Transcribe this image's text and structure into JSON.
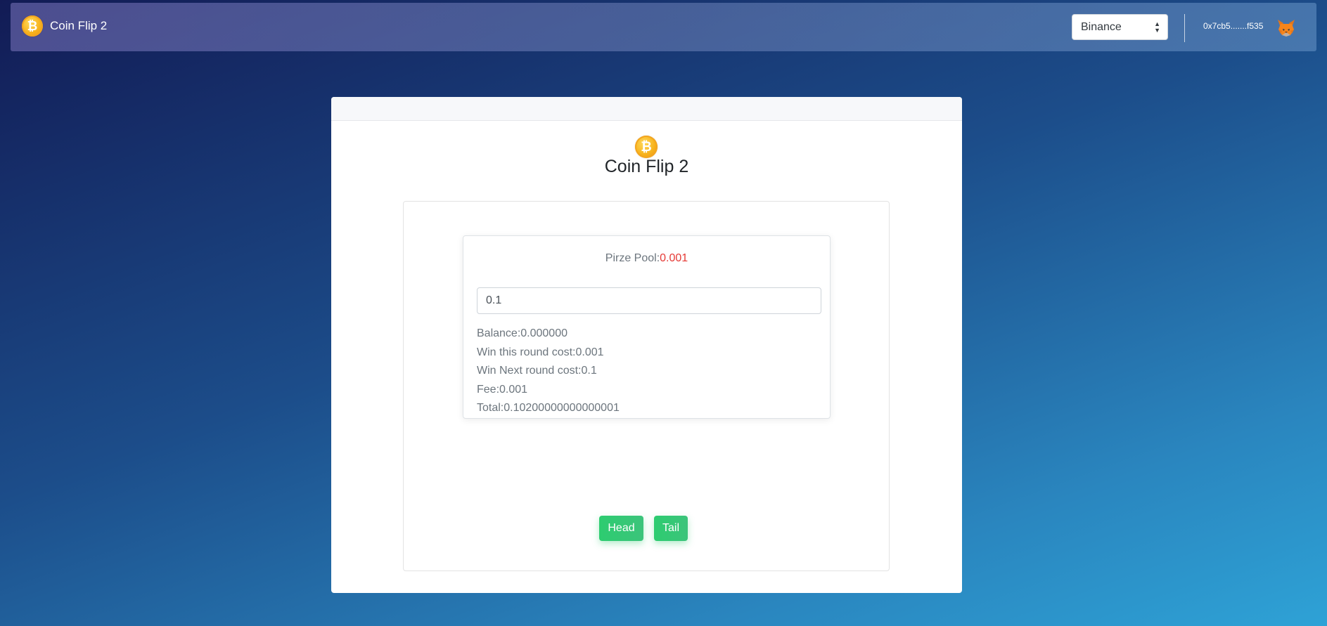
{
  "nav": {
    "brand_title": "Coin Flip 2",
    "brand_coin_symbol": "₿",
    "network_selected": "Binance",
    "wallet_address": "0x7cb5.......f535"
  },
  "main": {
    "coin_symbol": "₿",
    "title": "Coin Flip 2",
    "pool_label": "Pirze Pool:",
    "pool_value": "0.001",
    "amount_input_value": "0.1",
    "stats": {
      "balance": "Balance:0.000000",
      "win_this_round": "Win this round cost:0.001",
      "win_next_round": "Win Next round cost:0.1",
      "fee": "Fee:0.001",
      "total": "Total:0.10200000000000001"
    },
    "head_label": "Head",
    "tail_label": "Tail"
  },
  "colors": {
    "accent_green": "#2dcc70",
    "pool_value_red": "#e53935",
    "coin_gold": "#f7b21c"
  },
  "icons": {
    "brand": "bitcoin-coin-icon",
    "wallet": "metamask-fox-icon"
  }
}
